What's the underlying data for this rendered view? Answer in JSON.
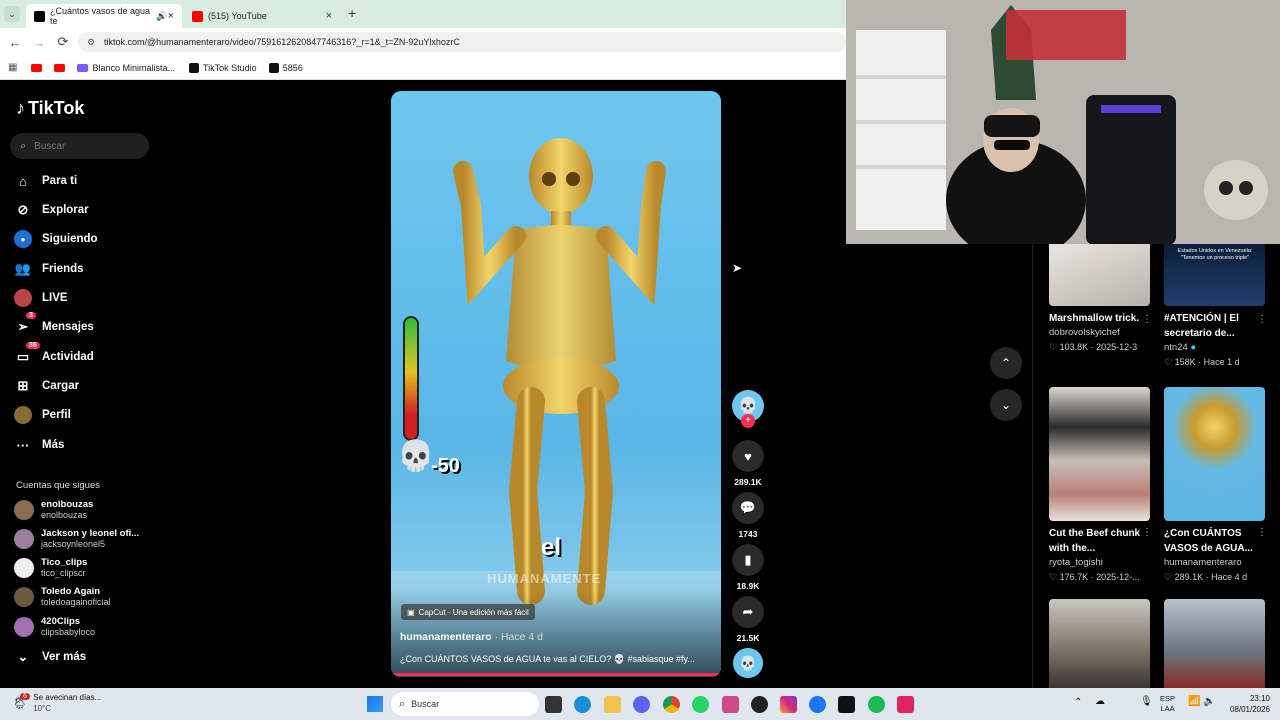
{
  "browser": {
    "tabs": [
      {
        "title": "¿Cuántos vasos de agua te",
        "active": true
      },
      {
        "title": "(515) YouTube",
        "active": false
      }
    ],
    "new_tab": "+",
    "url": "tiktok.com/@humanamenteraro/video/7591612620847746316?_r=1&_t=ZN-92uYlxhozrC",
    "bookmarks": [
      "Blanco Minimalista...",
      "TikTok Studio",
      "5856"
    ]
  },
  "app": {
    "logo": "TikTok",
    "search_placeholder": "Buscar",
    "nav": [
      {
        "label": "Para ti",
        "icon": "home-icon"
      },
      {
        "label": "Explorar",
        "icon": "compass-icon"
      },
      {
        "label": "Siguiendo",
        "icon": "following-icon"
      },
      {
        "label": "Friends",
        "icon": "friends-icon"
      },
      {
        "label": "LIVE",
        "icon": "live-icon"
      },
      {
        "label": "Mensajes",
        "icon": "messages-icon",
        "badge": "3"
      },
      {
        "label": "Actividad",
        "icon": "activity-icon",
        "badge": "36"
      },
      {
        "label": "Cargar",
        "icon": "upload-icon"
      },
      {
        "label": "Perfil",
        "icon": "profile-icon"
      },
      {
        "label": "Más",
        "icon": "more-icon"
      }
    ],
    "following_title": "Cuentas que sigues",
    "following": [
      {
        "name": "enolbouzas",
        "handle": "enolbouzas"
      },
      {
        "name": "Jackson y leonel ofi...",
        "handle": "jacksoynleonel5"
      },
      {
        "name": "Tico_clips",
        "handle": "tico_clipscr"
      },
      {
        "name": "Toledo Again",
        "handle": "toledoagainoficial"
      },
      {
        "name": "420Clips",
        "handle": "clipsbabyloco"
      }
    ],
    "see_more": "Ver más"
  },
  "video": {
    "overlay_word": "el",
    "watermark": "HUMANAMENTE",
    "counter": "-50",
    "capcut": "CapCut · Una edición más fácil",
    "author": "humanamenteraro",
    "posted": "· Hace 4 d",
    "description": "¿Con CUÁNTOS VASOS de AGUA te vas al CIELO? 💀 #sabiasque #fy...",
    "progress": 0.99,
    "likes": "289.1K",
    "comments": "1743",
    "saves": "18.9K",
    "shares": "21.5K"
  },
  "recommended": [
    {
      "title": "Marshmallow trick.",
      "author": "dobrovolskyichef",
      "likes": "103.8K",
      "date": "2025-12-3"
    },
    {
      "title": "#ATENCIÓN | El secretario de...",
      "author": "ntn24",
      "likes": "158K",
      "date": "Hace 1 d",
      "thumb_text": "Estados Unidos en Venezuela: \"Tenemos un proceso triple\""
    },
    {
      "title": "Cut the Beef chunk with the...",
      "author": "ryota_togishi",
      "likes": "176.7K",
      "date": "2025-12-..."
    },
    {
      "title": "¿Con CUÁNTOS VASOS de AGUA...",
      "author": "humanamenteraro",
      "likes": "289.1K",
      "date": "Hace 4 d"
    }
  ],
  "taskbar": {
    "weather_title": "Se avecinan días...",
    "weather_temp": "10°C",
    "weather_badge": "6",
    "search": "Buscar",
    "lang": "ESP",
    "lang2": "LAA",
    "time": "23:10",
    "date": "08/01/2026"
  },
  "colors": {
    "accent": "#fe2c55",
    "taskbar": "#dfe6ee",
    "tabbar": "#d9ece0"
  }
}
